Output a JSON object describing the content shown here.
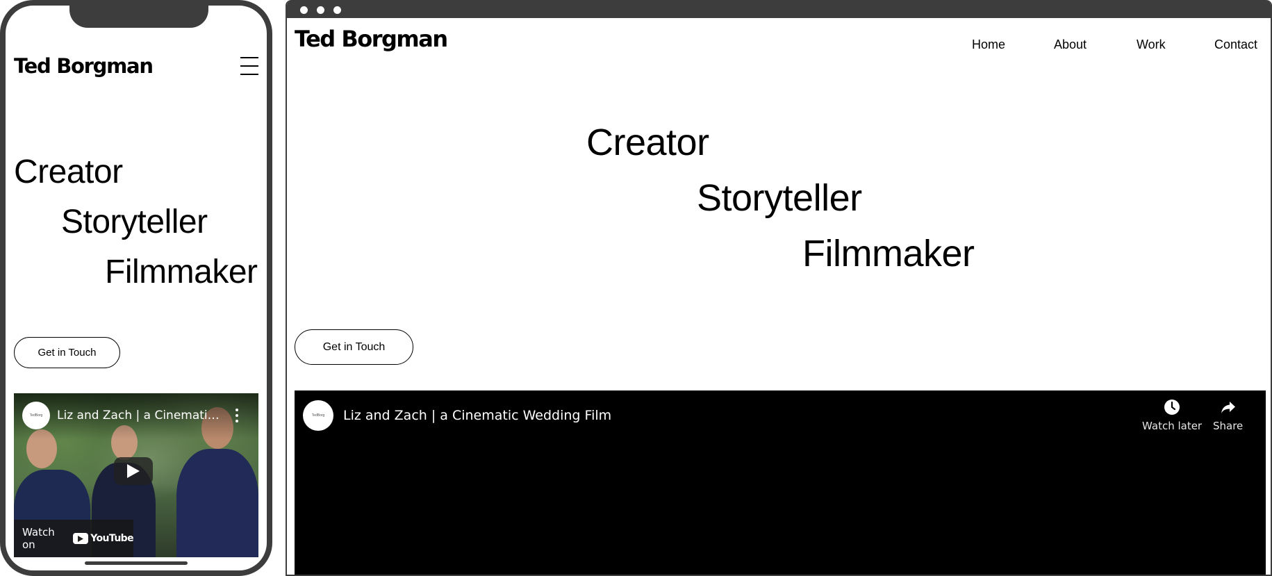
{
  "mobile": {
    "logo": "Ted Borgman",
    "menu_icon": "hamburger-menu-icon",
    "hero_lines": [
      "Creator",
      "Storyteller",
      "Filmmaker"
    ],
    "cta_label": "Get in Touch",
    "video": {
      "channel_avatar_text": "TedBorg",
      "title": "Liz and Zach | a Cinematic Wedding Film",
      "more_icon": "kebab-menu-icon",
      "play_icon": "play-icon",
      "watch_on_label": "Watch on",
      "youtube_label": "YouTube"
    }
  },
  "desktop": {
    "logo": "Ted Borgman",
    "nav": [
      {
        "label": "Home"
      },
      {
        "label": "About"
      },
      {
        "label": "Work"
      },
      {
        "label": "Contact"
      }
    ],
    "hero_lines": [
      "Creator",
      "Storyteller",
      "Filmmaker"
    ],
    "cta_label": "Get in Touch",
    "video": {
      "channel_avatar_text": "TedBorg",
      "title": "Liz and Zach | a Cinematic Wedding Film",
      "watch_later_label": "Watch later",
      "watch_later_icon": "clock-icon",
      "share_label": "Share",
      "share_icon": "share-arrow-icon"
    }
  },
  "colors": {
    "frame": "#3d3d3d",
    "text": "#000000",
    "background": "#ffffff",
    "video_bg": "#000000"
  }
}
